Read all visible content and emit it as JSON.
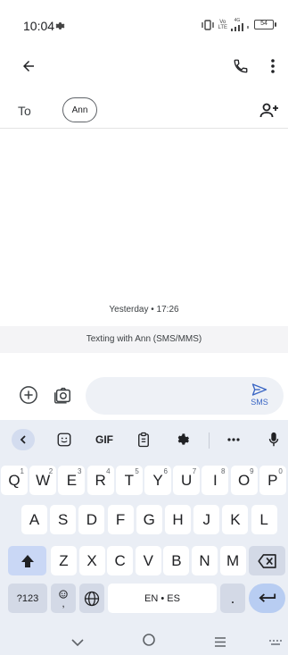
{
  "status": {
    "time": "10:04",
    "net_top": "Vo",
    "net_bottom": "LTE",
    "signal_label": "4G",
    "battery": "54"
  },
  "compose": {
    "to_label": "To",
    "recipient": "Ann",
    "date_stamp": "Yesterday • 17:26",
    "info": "Texting with Ann (SMS/MMS)",
    "send_label": "SMS"
  },
  "keyboard": {
    "toolbar": {
      "gif": "GIF"
    },
    "row1": [
      {
        "k": "Q",
        "h": "1"
      },
      {
        "k": "W",
        "h": "2"
      },
      {
        "k": "E",
        "h": "3"
      },
      {
        "k": "R",
        "h": "4"
      },
      {
        "k": "T",
        "h": "5"
      },
      {
        "k": "Y",
        "h": "6"
      },
      {
        "k": "U",
        "h": "7"
      },
      {
        "k": "I",
        "h": "8"
      },
      {
        "k": "O",
        "h": "9"
      },
      {
        "k": "P",
        "h": "0"
      }
    ],
    "row2": [
      "A",
      "S",
      "D",
      "F",
      "G",
      "H",
      "J",
      "K",
      "L"
    ],
    "row3": [
      "Z",
      "X",
      "C",
      "V",
      "B",
      "N",
      "M"
    ],
    "sym_label": "?123",
    "comma_label": ",",
    "space_label": "EN • ES",
    "period_label": "."
  },
  "colors": {
    "accent": "#3a66c4",
    "keyboard_bg": "#eaeef5"
  }
}
